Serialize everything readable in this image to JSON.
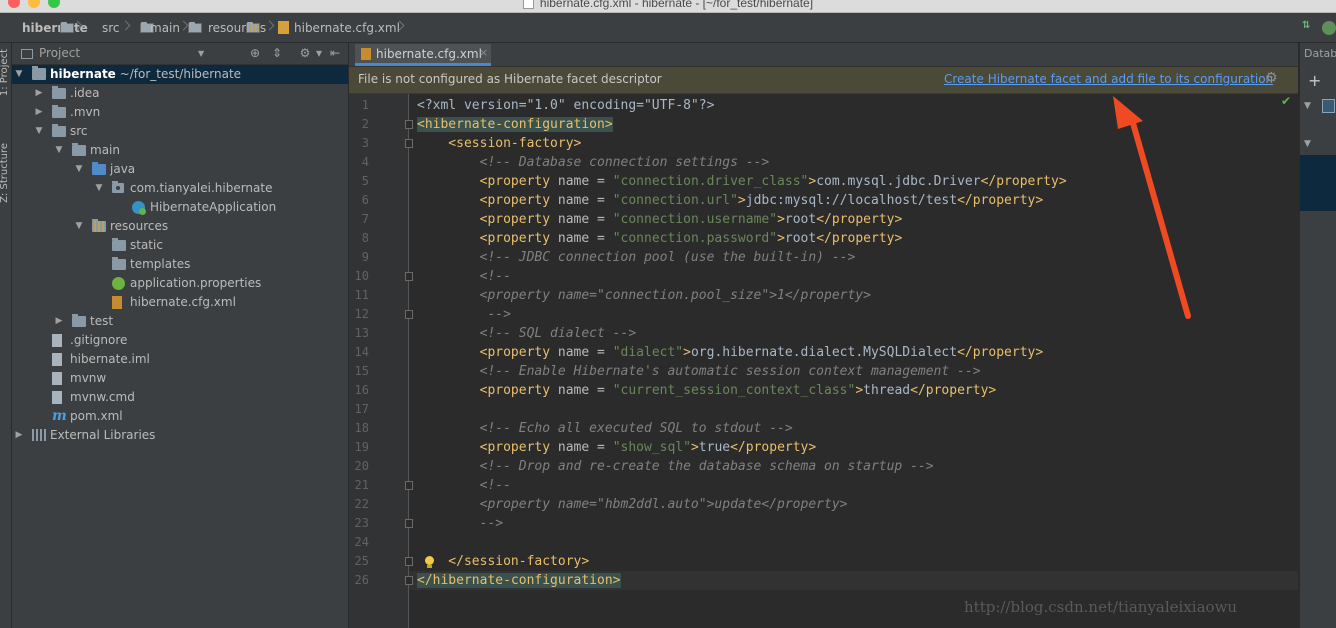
{
  "window": {
    "title": "hibernate.cfg.xml - hibernate - [~/for_test/hibernate]"
  },
  "breadcrumbs": [
    "hibernate",
    "src",
    "main",
    "resources",
    "hibernate.cfg.xml"
  ],
  "left_strip": {
    "tabs": [
      "1: Project",
      "Z: Structure"
    ]
  },
  "project_panel": {
    "title": "Project",
    "root": {
      "name": "hibernate",
      "path": "~/for_test/hibernate"
    },
    "items": [
      {
        "label": ".idea",
        "type": "folder",
        "depth": 1,
        "arrow": "collapsed"
      },
      {
        "label": ".mvn",
        "type": "folder",
        "depth": 1,
        "arrow": "collapsed"
      },
      {
        "label": "src",
        "type": "folder",
        "depth": 1,
        "arrow": "expanded"
      },
      {
        "label": "main",
        "type": "folder",
        "depth": 2,
        "arrow": "expanded"
      },
      {
        "label": "java",
        "type": "folder-blue",
        "depth": 3,
        "arrow": "expanded"
      },
      {
        "label": "com.tianyalei.hibernate",
        "type": "package",
        "depth": 4,
        "arrow": "expanded"
      },
      {
        "label": "HibernateApplication",
        "type": "class",
        "depth": 5,
        "arrow": ""
      },
      {
        "label": "resources",
        "type": "folder-res",
        "depth": 3,
        "arrow": "expanded"
      },
      {
        "label": "static",
        "type": "folder",
        "depth": 4,
        "arrow": ""
      },
      {
        "label": "templates",
        "type": "folder",
        "depth": 4,
        "arrow": ""
      },
      {
        "label": "application.properties",
        "type": "spring",
        "depth": 4,
        "arrow": ""
      },
      {
        "label": "hibernate.cfg.xml",
        "type": "xml",
        "depth": 4,
        "arrow": ""
      },
      {
        "label": "test",
        "type": "folder",
        "depth": 2,
        "arrow": "collapsed"
      },
      {
        "label": ".gitignore",
        "type": "file",
        "depth": 1,
        "arrow": ""
      },
      {
        "label": "hibernate.iml",
        "type": "iml",
        "depth": 1,
        "arrow": ""
      },
      {
        "label": "mvnw",
        "type": "file",
        "depth": 1,
        "arrow": ""
      },
      {
        "label": "mvnw.cmd",
        "type": "file",
        "depth": 1,
        "arrow": ""
      },
      {
        "label": "pom.xml",
        "type": "maven",
        "depth": 1,
        "arrow": ""
      },
      {
        "label": "External Libraries",
        "type": "lib",
        "depth": 0,
        "arrow": "collapsed"
      }
    ]
  },
  "editor": {
    "tab": "hibernate.cfg.xml",
    "banner": {
      "message": "File is not configured as Hibernate facet descriptor",
      "action": "Create Hibernate facet and add file to its configuration"
    },
    "current_line": 26,
    "lines": [
      [
        [
          "t",
          "<?xml version=\"1.0\" encoding=\"UTF-8\"?>"
        ]
      ],
      [
        [
          "tag",
          "<hibernate-configuration>",
          "hl"
        ]
      ],
      [
        [
          "tag",
          "    <session-factory>"
        ]
      ],
      [
        [
          "cmt",
          "        <!-- Database connection settings -->"
        ]
      ],
      [
        [
          "tag",
          "        <property "
        ],
        [
          "attr",
          "name = "
        ],
        [
          "str",
          "\"connection.driver_class\""
        ],
        [
          "tag",
          ">"
        ],
        [
          "t",
          "com.mysql.jdbc.Driver"
        ],
        [
          "tag",
          "</property>"
        ]
      ],
      [
        [
          "tag",
          "        <property "
        ],
        [
          "attr",
          "name = "
        ],
        [
          "str",
          "\"connection.url\""
        ],
        [
          "tag",
          ">"
        ],
        [
          "t",
          "jdbc:mysql://localhost/test"
        ],
        [
          "tag",
          "</property>"
        ]
      ],
      [
        [
          "tag",
          "        <property "
        ],
        [
          "attr",
          "name = "
        ],
        [
          "str",
          "\"connection.username\""
        ],
        [
          "tag",
          ">"
        ],
        [
          "t",
          "root"
        ],
        [
          "tag",
          "</property>"
        ]
      ],
      [
        [
          "tag",
          "        <property "
        ],
        [
          "attr",
          "name = "
        ],
        [
          "str",
          "\"connection.password\""
        ],
        [
          "tag",
          ">"
        ],
        [
          "t",
          "root"
        ],
        [
          "tag",
          "</property>"
        ]
      ],
      [
        [
          "cmt",
          "        <!-- JDBC connection pool (use the built-in) -->"
        ]
      ],
      [
        [
          "cmt",
          "        <!--"
        ]
      ],
      [
        [
          "cmt",
          "        <property name=\"connection.pool_size\">1</property>"
        ]
      ],
      [
        [
          "cmt",
          "         -->"
        ]
      ],
      [
        [
          "cmt",
          "        <!-- SQL dialect -->"
        ]
      ],
      [
        [
          "tag",
          "        <property "
        ],
        [
          "attr",
          "name = "
        ],
        [
          "str",
          "\"dialect\""
        ],
        [
          "tag",
          ">"
        ],
        [
          "t",
          "org.hibernate.dialect.MySQLDialect"
        ],
        [
          "tag",
          "</property>"
        ]
      ],
      [
        [
          "cmt",
          "        <!-- Enable Hibernate's automatic session context management -->"
        ]
      ],
      [
        [
          "tag",
          "        <property "
        ],
        [
          "attr",
          "name = "
        ],
        [
          "str",
          "\"current_session_context_class\""
        ],
        [
          "tag",
          ">"
        ],
        [
          "t",
          "thread"
        ],
        [
          "tag",
          "</property>"
        ]
      ],
      [],
      [
        [
          "cmt",
          "        <!-- Echo all executed SQL to stdout -->"
        ]
      ],
      [
        [
          "tag",
          "        <property "
        ],
        [
          "attr",
          "name = "
        ],
        [
          "str",
          "\"show_sql\""
        ],
        [
          "tag",
          ">"
        ],
        [
          "t",
          "true"
        ],
        [
          "tag",
          "</property>"
        ]
      ],
      [
        [
          "cmt",
          "        <!-- Drop and re-create the database schema on startup -->"
        ]
      ],
      [
        [
          "cmt",
          "        <!--"
        ]
      ],
      [
        [
          "cmt",
          "        <property name=\"hbm2ddl.auto\">update</property>"
        ]
      ],
      [
        [
          "cmt",
          "        -->"
        ]
      ],
      [],
      [
        [
          "tag",
          "    </session-factory>"
        ]
      ],
      [
        [
          "tag",
          "</hibernate-configuration>",
          "hl"
        ]
      ]
    ],
    "fold_lines": [
      2,
      3,
      10,
      12,
      21,
      23,
      25,
      26
    ],
    "bulb_line": 25
  },
  "right_panel": {
    "title": "Databa"
  },
  "watermark": "http://blog.csdn.net/tianyaleixiaowu",
  "colors": {
    "accent": "#4a88c7",
    "link": "#589df6",
    "annotation_arrow": "#f04a22",
    "banner": "#4b4937"
  }
}
